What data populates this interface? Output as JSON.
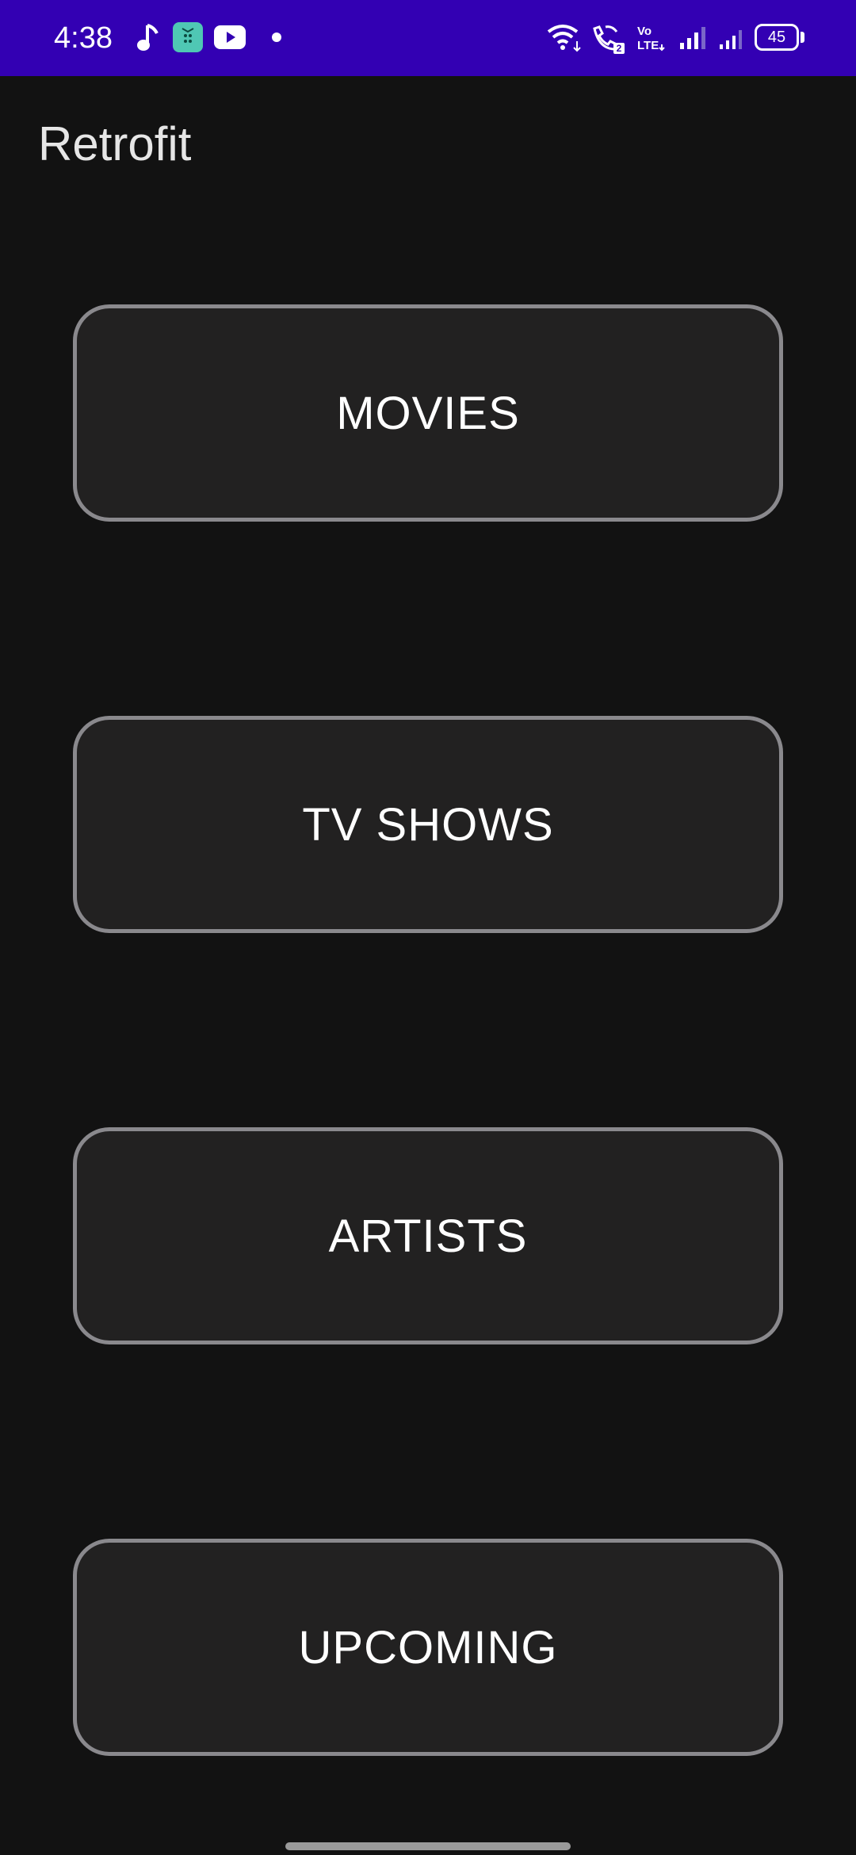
{
  "status_bar": {
    "time": "4:38",
    "network_label": "Vo\nLTE",
    "battery": "45",
    "background": "#3300b3",
    "icons": [
      "music-note-icon",
      "app-icon",
      "youtube-icon",
      "notification-dot-icon",
      "wifi-icon",
      "wifi-calling-icon",
      "volte-icon",
      "signal-icon",
      "signal-icon-2",
      "battery-icon"
    ]
  },
  "app_bar": {
    "title": "Retrofit"
  },
  "buttons": {
    "movies": "MOVIES",
    "tv_shows": "TV SHOWS",
    "artists": "ARTISTS",
    "upcoming": "UPCOMING"
  },
  "colors": {
    "background": "#121212",
    "button_fill": "#222121",
    "button_border": "#8a898d"
  }
}
